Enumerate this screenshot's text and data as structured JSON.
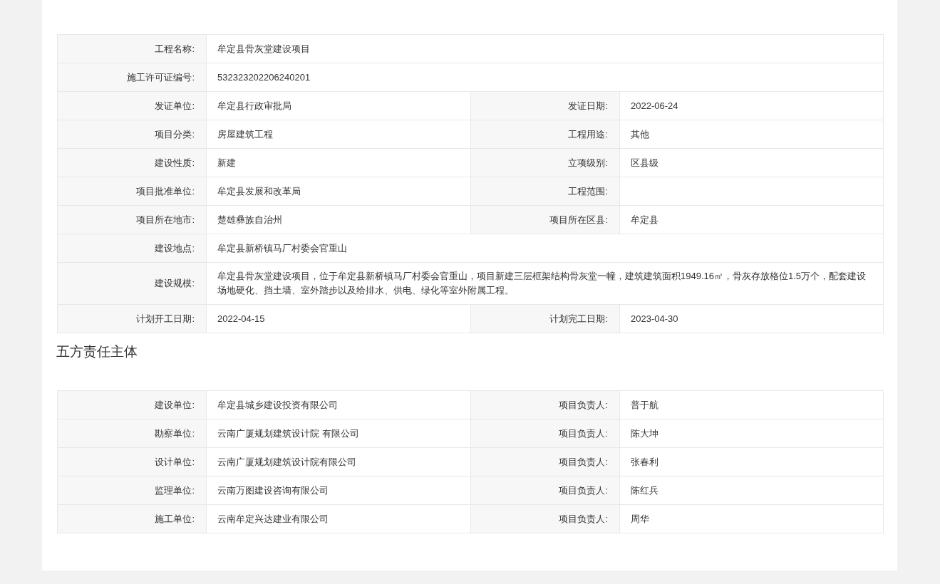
{
  "project_table": {
    "rows": [
      {
        "fields": [
          {
            "label": "工程名称:",
            "value": "牟定县骨灰堂建设项目"
          }
        ]
      },
      {
        "fields": [
          {
            "label": "施工许可证编号:",
            "value": "532323202206240201"
          }
        ]
      },
      {
        "fields": [
          {
            "label": "发证单位:",
            "value": "牟定县行政审批局"
          },
          {
            "label": "发证日期:",
            "value": "2022-06-24"
          }
        ]
      },
      {
        "fields": [
          {
            "label": "项目分类:",
            "value": "房屋建筑工程"
          },
          {
            "label": "工程用途:",
            "value": "其他"
          }
        ]
      },
      {
        "fields": [
          {
            "label": "建设性质:",
            "value": "新建"
          },
          {
            "label": "立项级别:",
            "value": "区县级"
          }
        ]
      },
      {
        "fields": [
          {
            "label": "项目批准单位:",
            "value": "牟定县发展和改革局"
          },
          {
            "label": "工程范围:"
          }
        ]
      },
      {
        "fields": [
          {
            "label": "项目所在地市:",
            "value": "楚雄彝族自治州"
          },
          {
            "label": "项目所在区县:",
            "value": "牟定县"
          }
        ]
      },
      {
        "fields": [
          {
            "label": "建设地点:",
            "value": "牟定县新桥镇马厂村委会官重山"
          }
        ]
      },
      {
        "fields": [
          {
            "label": "建设规模:",
            "value": "牟定县骨灰堂建设项目，位于牟定县新桥镇马厂村委会官重山，项目新建三层框架结构骨灰堂一幢，建筑建筑面积1949.16㎡，骨灰存放格位1.5万个，配套建设场地硬化、挡土墙、室外踏步以及给排水、供电、绿化等室外附属工程。"
          }
        ]
      },
      {
        "fields": [
          {
            "label": "计划开工日期:",
            "value": "2022-04-15"
          },
          {
            "label": "计划完工日期:",
            "value": "2023-04-30"
          }
        ]
      }
    ]
  },
  "parties_section": {
    "title": "五方责任主体",
    "rows": [
      {
        "fields": [
          {
            "label": "建设单位:",
            "value": "牟定县城乡建设投资有限公司"
          },
          {
            "label": "项目负责人:",
            "value": "普于航"
          }
        ]
      },
      {
        "fields": [
          {
            "label": "勘察单位:",
            "value": "云南广厦规划建筑设计院 有限公司"
          },
          {
            "label": "项目负责人:",
            "value": "陈大坤"
          }
        ]
      },
      {
        "fields": [
          {
            "label": "设计单位:",
            "value": "云南广厦规划建筑设计院有限公司"
          },
          {
            "label": "项目负责人:",
            "value": "张春利"
          }
        ]
      },
      {
        "fields": [
          {
            "label": "监理单位:",
            "value": "云南万图建设咨询有限公司"
          },
          {
            "label": "项目负责人:",
            "value": "陈红兵"
          }
        ]
      },
      {
        "fields": [
          {
            "label": "施工单位:",
            "value": "云南牟定兴达建业有限公司"
          },
          {
            "label": "项目负责人:",
            "value": "周华"
          }
        ]
      }
    ]
  }
}
